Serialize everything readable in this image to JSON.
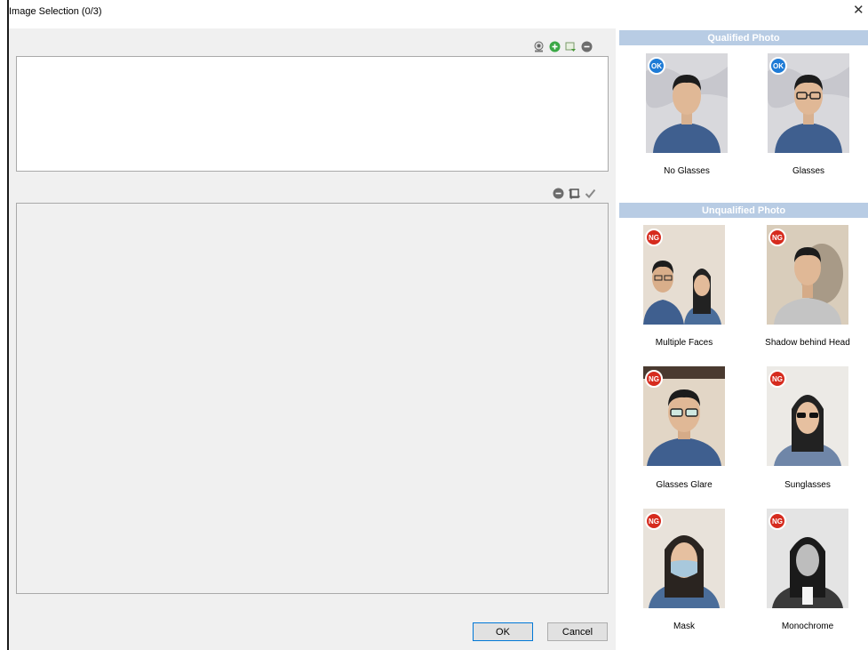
{
  "window": {
    "title": "Image Selection (0/3)",
    "close_glyph": "✕"
  },
  "toolbar_top": {
    "icons": [
      "webcam-icon",
      "add-icon",
      "import-icon",
      "remove-icon"
    ]
  },
  "toolbar_bottom": {
    "icons": [
      "remove-icon",
      "crop-icon",
      "check-icon"
    ]
  },
  "buttons": {
    "ok_label": "OK",
    "cancel_label": "Cancel"
  },
  "qualified": {
    "heading": "Qualified Photo",
    "badge": "OK",
    "items": [
      {
        "caption": "No Glasses",
        "variant": "no-glasses"
      },
      {
        "caption": "Glasses",
        "variant": "glasses"
      }
    ]
  },
  "unqualified": {
    "heading": "Unqualified Photo",
    "badge": "NG",
    "items": [
      {
        "caption": "Multiple Faces",
        "variant": "multiple-faces"
      },
      {
        "caption": "Shadow behind Head",
        "variant": "shadow"
      },
      {
        "caption": "Glasses Glare",
        "variant": "glare"
      },
      {
        "caption": "Sunglasses",
        "variant": "sunglasses"
      },
      {
        "caption": "Mask",
        "variant": "mask"
      },
      {
        "caption": "Monochrome",
        "variant": "monochrome"
      }
    ]
  },
  "colors": {
    "section_header": "#b8cce4",
    "badge_ok": "#1e7bd6",
    "badge_ng": "#d62b1e",
    "pane_bg": "#f0f0f0"
  }
}
